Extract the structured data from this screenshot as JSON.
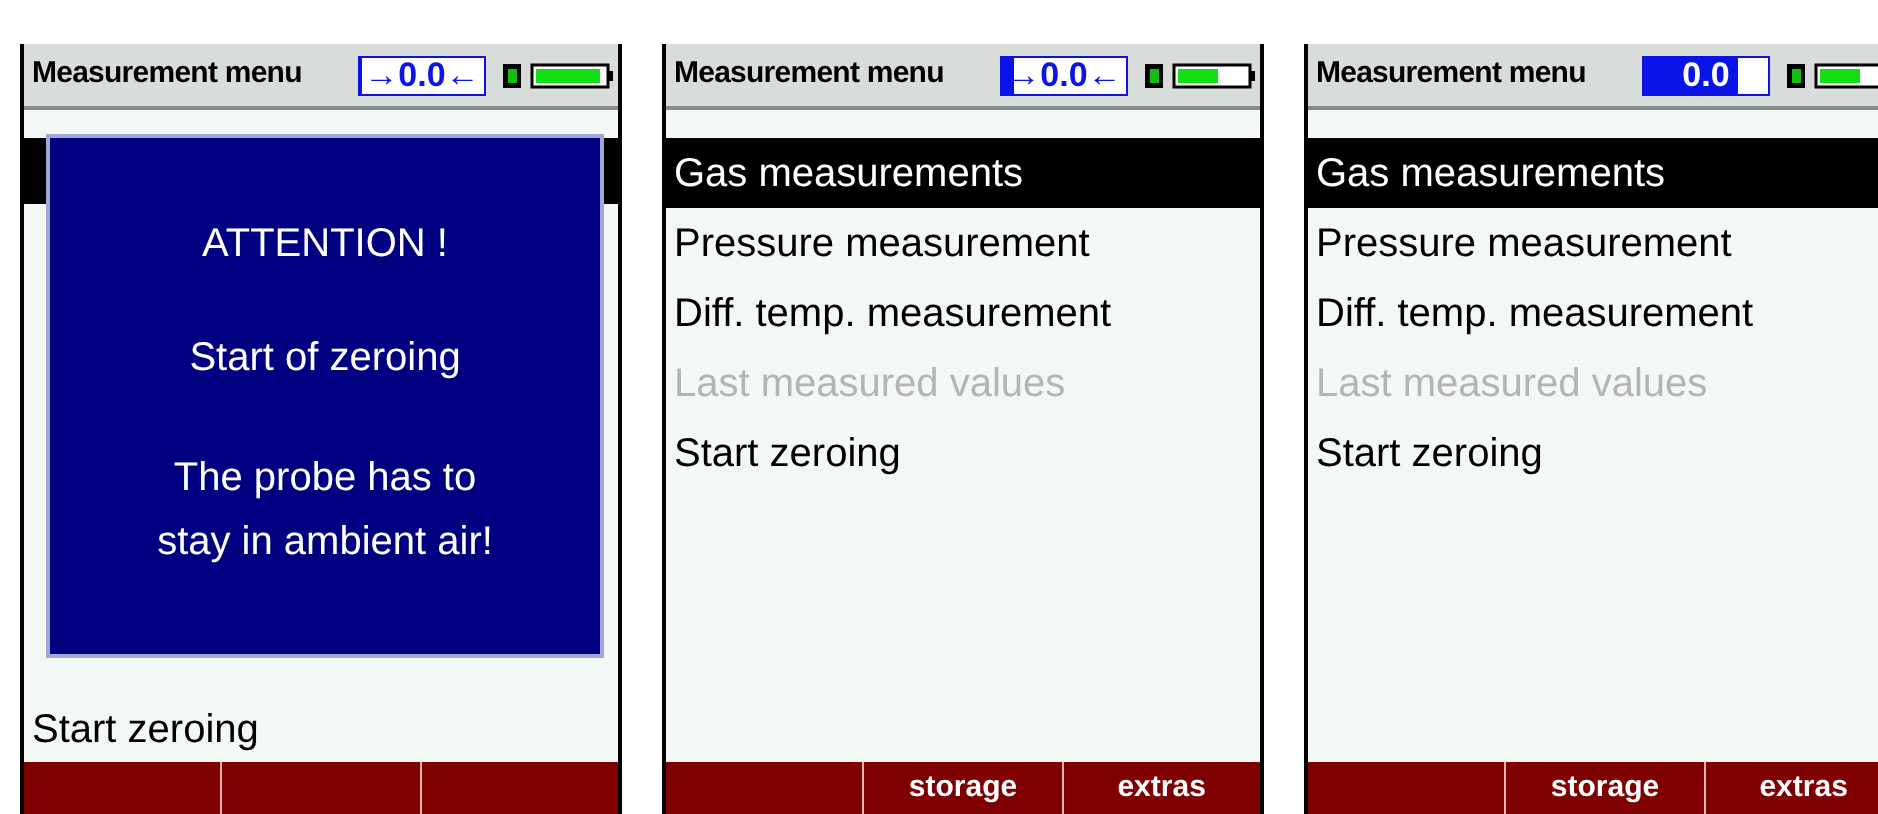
{
  "screens": [
    {
      "header": {
        "title": "Measurement menu",
        "zero_indicator": {
          "text": "→0.0←",
          "level": 0
        }
      },
      "menu": [
        {
          "selected": true
        },
        {
          "label": "Start zeroing",
          "selected": false
        }
      ],
      "dialog": {
        "title": "ATTENTION !",
        "lines": [
          "Start of zeroing",
          "The probe has to stay in ambient air!"
        ]
      }
    },
    {
      "header": {
        "title": "Measurement menu",
        "zero_indicator": {
          "text": "→0.0←",
          "level": 0.1
        }
      },
      "menu": [
        {
          "label": "Gas measurements",
          "selected": true,
          "disabled": false
        },
        {
          "label": "Pressure measurement",
          "selected": false,
          "disabled": false
        },
        {
          "label": "Diff. temp. measurement",
          "selected": false,
          "disabled": false
        },
        {
          "label": "Last measured values",
          "selected": false,
          "disabled": true
        },
        {
          "label": "Start zeroing",
          "selected": false,
          "disabled": false
        }
      ],
      "softkeys": [
        "storage",
        "extras"
      ]
    },
    {
      "header": {
        "title": "Measurement menu",
        "zero_indicator": {
          "text": "0.0",
          "level": 0.76
        }
      },
      "menu": [
        {
          "label": "Gas measurements",
          "selected": true,
          "disabled": false
        },
        {
          "label": "Pressure measurement",
          "selected": false,
          "disabled": false
        },
        {
          "label": "Diff. temp. measurement",
          "selected": false,
          "disabled": false
        },
        {
          "label": "Last measured values",
          "selected": false,
          "disabled": true
        },
        {
          "label": "Start zeroing",
          "selected": false,
          "disabled": false
        }
      ],
      "softkeys": [
        "storage",
        "extras"
      ]
    }
  ]
}
